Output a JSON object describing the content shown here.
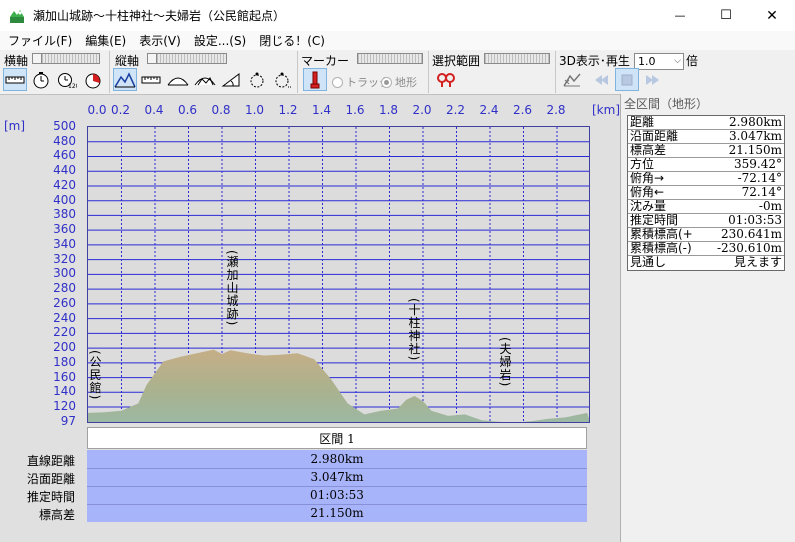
{
  "window": {
    "title": "瀬加山城跡～十柱神社～夫婦岩（公民館起点）",
    "minimize": "—",
    "maximize": "☐",
    "close": "✕"
  },
  "menu": [
    "ファイル(F)",
    "編集(E)",
    "表示(V)",
    "設定...(S)",
    "閉じる！(C)"
  ],
  "toolbar": {
    "horizontal_axis_label": "横軸",
    "vertical_axis_label": "縦軸",
    "marker_label": "マーカー",
    "selection_label": "選択範囲",
    "view3d_label": "3D表示･再生",
    "radio_track": "トラック",
    "radio_terrain": "地形",
    "speed_value": "1.0",
    "speed_unit": "倍",
    "icons": [
      "ruler-icon",
      "clock-icon",
      "clock-120-icon",
      "pie-icon",
      "mountain-icon",
      "ruler-v-icon",
      "arc-icon",
      "arc-bump-icon",
      "slope-icon",
      "hiker-icon",
      "hiker-dots-icon",
      "marker-pin-icon",
      "map-pin-icon",
      "mountain-play-icon",
      "prev-icon",
      "stop-icon",
      "next-icon"
    ]
  },
  "chart": {
    "x_unit": "[km]",
    "y_unit": "[m]",
    "section_label": "区間 1",
    "stats_labels": [
      "直線距離",
      "沿面距離",
      "推定時間",
      "標高差"
    ],
    "stats_values": [
      "2.980km",
      "3.047km",
      "01:03:53",
      "21.150m"
    ]
  },
  "chart_data": {
    "type": "area",
    "xlabel": "[km]",
    "ylabel": "[m]",
    "xlim": [
      0.0,
      2.98
    ],
    "ylim": [
      97,
      500
    ],
    "x_ticks": [
      "0.0",
      "0.2",
      "0.4",
      "0.6",
      "0.8",
      "1.0",
      "1.2",
      "1.4",
      "1.6",
      "1.8",
      "2.0",
      "2.2",
      "2.4",
      "2.6",
      "2.8"
    ],
    "y_ticks": [
      "500",
      "480",
      "460",
      "440",
      "420",
      "400",
      "380",
      "360",
      "340",
      "320",
      "300",
      "280",
      "260",
      "240",
      "220",
      "200",
      "180",
      "160",
      "140",
      "120",
      "97"
    ],
    "x": [
      0.0,
      0.1,
      0.2,
      0.3,
      0.35,
      0.45,
      0.55,
      0.65,
      0.75,
      0.8,
      0.85,
      0.95,
      1.05,
      1.15,
      1.25,
      1.35,
      1.45,
      1.55,
      1.65,
      1.75,
      1.85,
      1.9,
      1.95,
      2.0,
      2.05,
      2.15,
      2.25,
      2.35,
      2.45,
      2.55,
      2.65,
      2.75,
      2.85,
      2.98
    ],
    "y": [
      112,
      113,
      115,
      125,
      150,
      182,
      188,
      193,
      198,
      192,
      197,
      193,
      190,
      191,
      193,
      185,
      158,
      125,
      110,
      115,
      118,
      130,
      135,
      128,
      115,
      108,
      110,
      102,
      100,
      99,
      101,
      104,
      106,
      112
    ],
    "annotations": [
      {
        "label": "(公民館)",
        "x": 0.0
      },
      {
        "label": "(瀬加山城跡)",
        "x": 0.85
      },
      {
        "label": "(十柱神社)",
        "x": 1.97
      },
      {
        "label": "(夫婦岩)",
        "x": 2.5
      }
    ]
  },
  "panel": {
    "title": "全区間（地形）",
    "rows": [
      {
        "key": "距離",
        "value": "2.980km"
      },
      {
        "key": "沿面距離",
        "value": "3.047km"
      },
      {
        "key": "標高差",
        "value": "21.150m"
      },
      {
        "key": "方位",
        "value": "359.42°"
      },
      {
        "key": "俯角→",
        "value": "-72.14°"
      },
      {
        "key": "俯角←",
        "value": "72.14°"
      },
      {
        "key": "沈み量",
        "value": "-0m"
      },
      {
        "key": "推定時間",
        "value": "01:03:53"
      },
      {
        "key": "累積標高(+)",
        "value": "230.641m"
      },
      {
        "key": "累積標高(-)",
        "value": "-230.610m"
      },
      {
        "key": "見通し",
        "value": "見えます"
      }
    ]
  }
}
